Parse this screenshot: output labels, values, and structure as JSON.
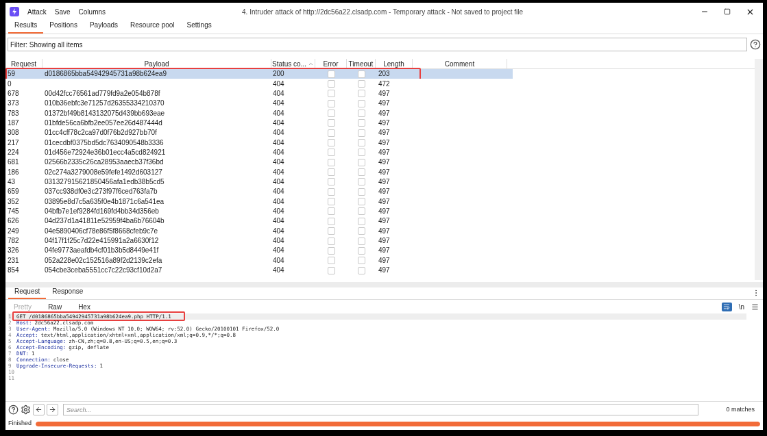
{
  "window": {
    "title": "4. Intruder attack of http://2dc56a22.clsadp.com - Temporary attack - Not saved to project file",
    "menu": [
      "Attack",
      "Save",
      "Columns"
    ]
  },
  "tabs": [
    {
      "label": "Results",
      "selected": true
    },
    {
      "label": "Positions",
      "selected": false
    },
    {
      "label": "Payloads",
      "selected": false
    },
    {
      "label": "Resource pool",
      "selected": false
    },
    {
      "label": "Settings",
      "selected": false
    }
  ],
  "filter": {
    "text": "Filter: Showing all items"
  },
  "table": {
    "columns": [
      "Request",
      "Payload",
      "Status co...",
      "Error",
      "Timeout",
      "Length",
      "Comment"
    ],
    "rows": [
      {
        "request": "59",
        "payload": "d0186865bba54942945731a98b624ea9",
        "status": "200",
        "error": false,
        "timeout": false,
        "length": "203",
        "selected": true,
        "highlighted": true
      },
      {
        "request": "0",
        "status": "404",
        "error": false,
        "timeout": false,
        "length": "472",
        "selected": false
      },
      {
        "request": "678",
        "payload": "00d42fcc76561ad779fd9a2e054b878f",
        "status": "404",
        "error": false,
        "timeout": false,
        "length": "497",
        "selected": false
      },
      {
        "request": "373",
        "payload": "010b36ebfc3e71257d26355334210370",
        "status": "404",
        "error": false,
        "timeout": false,
        "length": "497",
        "selected": false
      },
      {
        "request": "783",
        "payload": "01372bf49b8143132075d439bb693eae",
        "status": "404",
        "error": false,
        "timeout": false,
        "length": "497",
        "selected": false
      },
      {
        "request": "187",
        "payload": "01bfde56ca6bfb2ee057ee26d487444d",
        "status": "404",
        "error": false,
        "timeout": false,
        "length": "497",
        "selected": false
      },
      {
        "request": "308",
        "payload": "01cc4cff78c2ca97d0f76b2d927bb70f",
        "status": "404",
        "error": false,
        "timeout": false,
        "length": "497",
        "selected": false
      },
      {
        "request": "217",
        "payload": "01cecdbf0375bd5dc7634090548b3336",
        "status": "404",
        "error": false,
        "timeout": false,
        "length": "497",
        "selected": false
      },
      {
        "request": "224",
        "payload": "01d456e72924e36b01ecc4a5cd824921",
        "status": "404",
        "error": false,
        "timeout": false,
        "length": "497",
        "selected": false
      },
      {
        "request": "681",
        "payload": "02566b2335c26ca28953aaecb37f36bd",
        "status": "404",
        "error": false,
        "timeout": false,
        "length": "497",
        "selected": false
      },
      {
        "request": "186",
        "payload": "02c274a3279008e59fefe1492d603127",
        "status": "404",
        "error": false,
        "timeout": false,
        "length": "497",
        "selected": false
      },
      {
        "request": "43",
        "payload": "031327915621850456afa1edb38b5cd5",
        "status": "404",
        "error": false,
        "timeout": false,
        "length": "497",
        "selected": false
      },
      {
        "request": "659",
        "payload": "037cc938df0e3c273f97f6ced763fa7b",
        "status": "404",
        "error": false,
        "timeout": false,
        "length": "497",
        "selected": false
      },
      {
        "request": "352",
        "payload": "03895e8d7c5a635f0e4b1871c6a541ea",
        "status": "404",
        "error": false,
        "timeout": false,
        "length": "497",
        "selected": false
      },
      {
        "request": "745",
        "payload": "04bfb7e1ef9284fd169fd4bb34d356eb",
        "status": "404",
        "error": false,
        "timeout": false,
        "length": "497",
        "selected": false
      },
      {
        "request": "626",
        "payload": "04d237d1a41811e52959f4ba6b76604b",
        "status": "404",
        "error": false,
        "timeout": false,
        "length": "497",
        "selected": false
      },
      {
        "request": "249",
        "payload": "04e5890406cf78e86f5f8668cfeb9c7e",
        "status": "404",
        "error": false,
        "timeout": false,
        "length": "497",
        "selected": false
      },
      {
        "request": "782",
        "payload": "04f17f1f25c7d22e415991a2a6630f12",
        "status": "404",
        "error": false,
        "timeout": false,
        "length": "497",
        "selected": false
      },
      {
        "request": "326",
        "payload": "04fe9773aeafdb4cf01b3b5d8449e41f",
        "status": "404",
        "error": false,
        "timeout": false,
        "length": "497",
        "selected": false
      },
      {
        "request": "231",
        "payload": "052a228e02c152516a89f2d2139c2efa",
        "status": "404",
        "error": false,
        "timeout": false,
        "length": "497",
        "selected": false
      },
      {
        "request": "854",
        "payload": "054cbe3ceba5551cc7c22c93cf10d2a7",
        "status": "404",
        "error": false,
        "timeout": false,
        "length": "497",
        "selected": false
      }
    ]
  },
  "message_tabs": [
    {
      "label": "Request",
      "selected": true
    },
    {
      "label": "Response",
      "selected": false
    }
  ],
  "view_tabs": [
    {
      "label": "Pretty",
      "disabled": true
    },
    {
      "label": "Raw",
      "disabled": false
    },
    {
      "label": "Hex",
      "disabled": false
    }
  ],
  "toolbar": {
    "newline_toggle": "\\n"
  },
  "editor": {
    "lines": [
      {
        "number": "1",
        "kind": "request",
        "text": "GET /d0186865bba54942945731a98b624ea9.php HTTP/1.1",
        "highlighted": true
      },
      {
        "number": "2",
        "kind": "header",
        "name": "Host:",
        "value": "2dc56a22.clsadp.com"
      },
      {
        "number": "3",
        "kind": "header",
        "name": "User-Agent:",
        "value": "Mozilla/5.0 (Windows NT 10.0; WOW64; rv:52.0) Gecko/20100101 Firefox/52.0"
      },
      {
        "number": "4",
        "kind": "header",
        "name": "Accept:",
        "value": "text/html,application/xhtml+xml,application/xml;q=0.9,*/*;q=0.8"
      },
      {
        "number": "5",
        "kind": "header",
        "name": "Accept-Language:",
        "value": "zh-CN,zh;q=0.8,en-US;q=0.5,en;q=0.3"
      },
      {
        "number": "6",
        "kind": "header",
        "name": "Accept-Encoding:",
        "value": "gzip, deflate"
      },
      {
        "number": "7",
        "kind": "header",
        "name": "DNT:",
        "value": "1"
      },
      {
        "number": "8",
        "kind": "header",
        "name": "Connection:",
        "value": "close"
      },
      {
        "number": "9",
        "kind": "header",
        "name": "Upgrade-Insecure-Requests:",
        "value": "1"
      },
      {
        "number": "10",
        "kind": "blank"
      },
      {
        "number": "11",
        "kind": "blank"
      }
    ]
  },
  "search": {
    "placeholder": "Search...",
    "matches": "0 matches"
  },
  "status_bar": {
    "text": "Finished",
    "level": 1
  }
}
